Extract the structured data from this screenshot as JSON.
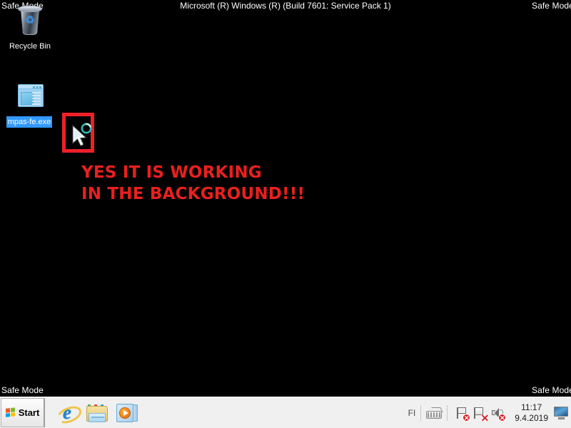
{
  "desktop": {
    "background_color": "#000000",
    "build_banner": "Microsoft (R) Windows (R) (Build 7601: Service Pack 1)",
    "safe_mode_watermarks": {
      "top_left": "Safe Mode",
      "top_right": "Safe Mode",
      "bottom_left": "Safe Mode",
      "bottom_right": "Safe Mode"
    },
    "icons": [
      {
        "label": "Recycle Bin",
        "icon": "recycle-bin-icon",
        "selected": false
      },
      {
        "label": "mpas-fe.exe",
        "icon": "application-window-icon",
        "selected": true,
        "selection_color": "#3399ff"
      }
    ],
    "annotation": {
      "line1": "YES IT IS WORKING",
      "line2": "IN THE BACKGROUND!!!",
      "color": "#e8201f"
    },
    "highlight_box": {
      "name": "busy-cursor-highlight",
      "border_color": "#ef2027",
      "contains": "working-in-background-cursor",
      "cursor_spinner_color": "#2fb8b0"
    }
  },
  "taskbar": {
    "background_color": "#f0f0f0",
    "start_label": "Start",
    "quick_launch": [
      {
        "name": "internet-explorer",
        "title": "Internet Explorer"
      },
      {
        "name": "windows-explorer",
        "title": "Windows Explorer"
      },
      {
        "name": "windows-media-player",
        "title": "Windows Media Player"
      }
    ],
    "tray": {
      "language_code": "FI",
      "keyboard_icon": "keyboard-icon",
      "icons": [
        {
          "name": "network-icon",
          "status": "error",
          "badge": "x"
        },
        {
          "name": "action-center-icon",
          "status": "error",
          "badge": "x"
        },
        {
          "name": "volume-icon",
          "status": "error",
          "badge": "x"
        }
      ],
      "clock": {
        "time": "11:17",
        "date": "9.4.2019"
      },
      "show_desktop": "show-desktop-icon"
    }
  }
}
